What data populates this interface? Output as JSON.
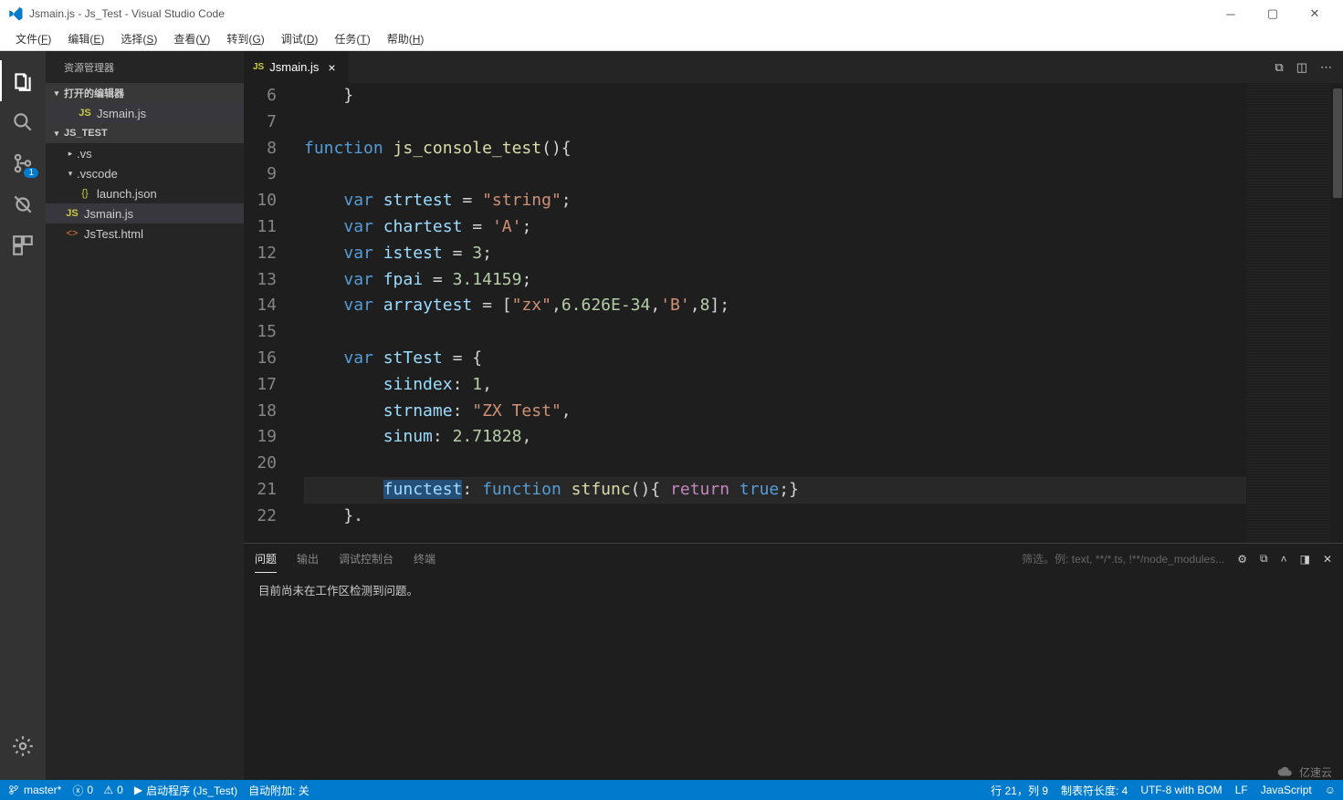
{
  "window": {
    "title": "Jsmain.js - Js_Test - Visual Studio Code"
  },
  "menu": {
    "items": [
      {
        "label": "文件",
        "mn": "F"
      },
      {
        "label": "编辑",
        "mn": "E"
      },
      {
        "label": "选择",
        "mn": "S"
      },
      {
        "label": "查看",
        "mn": "V"
      },
      {
        "label": "转到",
        "mn": "G"
      },
      {
        "label": "调试",
        "mn": "D"
      },
      {
        "label": "任务",
        "mn": "T"
      },
      {
        "label": "帮助",
        "mn": "H"
      }
    ]
  },
  "activity": {
    "debug_badge": "1"
  },
  "sidebar": {
    "title": "资源管理器",
    "open_editors": "打开的编辑器",
    "open_file": "Jsmain.js",
    "workspace": "JS_TEST",
    "folders": [
      {
        "name": ".vs",
        "expanded": false
      },
      {
        "name": ".vscode",
        "expanded": true
      }
    ],
    "files": {
      "launch": "launch.json",
      "jsmain": "Jsmain.js",
      "jstest": "JsTest.html"
    }
  },
  "tab": {
    "name": "Jsmain.js"
  },
  "code": {
    "lines": [
      {
        "n": "6",
        "tokens": [
          {
            "c": "tk-pl",
            "t": "    }"
          }
        ]
      },
      {
        "n": "7",
        "tokens": []
      },
      {
        "n": "8",
        "tokens": [
          {
            "c": "tk-kw",
            "t": "function"
          },
          {
            "c": "tk-pl",
            "t": " "
          },
          {
            "c": "tk-fn",
            "t": "js_console_test"
          },
          {
            "c": "tk-pl",
            "t": "(){"
          }
        ]
      },
      {
        "n": "9",
        "tokens": []
      },
      {
        "n": "10",
        "tokens": [
          {
            "c": "tk-pl",
            "t": "    "
          },
          {
            "c": "tk-kw",
            "t": "var"
          },
          {
            "c": "tk-pl",
            "t": " "
          },
          {
            "c": "tk-id",
            "t": "strtest"
          },
          {
            "c": "tk-pl",
            "t": " = "
          },
          {
            "c": "tk-str",
            "t": "\"string\""
          },
          {
            "c": "tk-pl",
            "t": ";"
          }
        ]
      },
      {
        "n": "11",
        "tokens": [
          {
            "c": "tk-pl",
            "t": "    "
          },
          {
            "c": "tk-kw",
            "t": "var"
          },
          {
            "c": "tk-pl",
            "t": " "
          },
          {
            "c": "tk-id",
            "t": "chartest"
          },
          {
            "c": "tk-pl",
            "t": " = "
          },
          {
            "c": "tk-str",
            "t": "'A'"
          },
          {
            "c": "tk-pl",
            "t": ";"
          }
        ]
      },
      {
        "n": "12",
        "tokens": [
          {
            "c": "tk-pl",
            "t": "    "
          },
          {
            "c": "tk-kw",
            "t": "var"
          },
          {
            "c": "tk-pl",
            "t": " "
          },
          {
            "c": "tk-id",
            "t": "istest"
          },
          {
            "c": "tk-pl",
            "t": " = "
          },
          {
            "c": "tk-num",
            "t": "3"
          },
          {
            "c": "tk-pl",
            "t": ";"
          }
        ]
      },
      {
        "n": "13",
        "tokens": [
          {
            "c": "tk-pl",
            "t": "    "
          },
          {
            "c": "tk-kw",
            "t": "var"
          },
          {
            "c": "tk-pl",
            "t": " "
          },
          {
            "c": "tk-id",
            "t": "fpai"
          },
          {
            "c": "tk-pl",
            "t": " = "
          },
          {
            "c": "tk-num",
            "t": "3.14159"
          },
          {
            "c": "tk-pl",
            "t": ";"
          }
        ]
      },
      {
        "n": "14",
        "tokens": [
          {
            "c": "tk-pl",
            "t": "    "
          },
          {
            "c": "tk-kw",
            "t": "var"
          },
          {
            "c": "tk-pl",
            "t": " "
          },
          {
            "c": "tk-id",
            "t": "arraytest"
          },
          {
            "c": "tk-pl",
            "t": " = ["
          },
          {
            "c": "tk-str",
            "t": "\"zx\""
          },
          {
            "c": "tk-pl",
            "t": ","
          },
          {
            "c": "tk-num",
            "t": "6.626E-34"
          },
          {
            "c": "tk-pl",
            "t": ","
          },
          {
            "c": "tk-str",
            "t": "'B'"
          },
          {
            "c": "tk-pl",
            "t": ","
          },
          {
            "c": "tk-num",
            "t": "8"
          },
          {
            "c": "tk-pl",
            "t": "];"
          }
        ]
      },
      {
        "n": "15",
        "tokens": []
      },
      {
        "n": "16",
        "tokens": [
          {
            "c": "tk-pl",
            "t": "    "
          },
          {
            "c": "tk-kw",
            "t": "var"
          },
          {
            "c": "tk-pl",
            "t": " "
          },
          {
            "c": "tk-id",
            "t": "stTest"
          },
          {
            "c": "tk-pl",
            "t": " = {"
          }
        ]
      },
      {
        "n": "17",
        "tokens": [
          {
            "c": "tk-pl",
            "t": "        "
          },
          {
            "c": "tk-id",
            "t": "siindex"
          },
          {
            "c": "tk-pl",
            "t": ": "
          },
          {
            "c": "tk-num",
            "t": "1"
          },
          {
            "c": "tk-pl",
            "t": ","
          }
        ]
      },
      {
        "n": "18",
        "tokens": [
          {
            "c": "tk-pl",
            "t": "        "
          },
          {
            "c": "tk-id",
            "t": "strname"
          },
          {
            "c": "tk-pl",
            "t": ": "
          },
          {
            "c": "tk-str",
            "t": "\"ZX Test\""
          },
          {
            "c": "tk-pl",
            "t": ","
          }
        ]
      },
      {
        "n": "19",
        "tokens": [
          {
            "c": "tk-pl",
            "t": "        "
          },
          {
            "c": "tk-id",
            "t": "sinum"
          },
          {
            "c": "tk-pl",
            "t": ": "
          },
          {
            "c": "tk-num",
            "t": "2.71828"
          },
          {
            "c": "tk-pl",
            "t": ","
          }
        ]
      },
      {
        "n": "20",
        "tokens": []
      },
      {
        "n": "21",
        "cur": true,
        "tokens": [
          {
            "c": "tk-pl",
            "t": "        "
          },
          {
            "c": "tk-id sel",
            "t": "functest"
          },
          {
            "c": "tk-pl",
            "t": ": "
          },
          {
            "c": "tk-kw",
            "t": "function"
          },
          {
            "c": "tk-pl",
            "t": " "
          },
          {
            "c": "tk-fn",
            "t": "stfunc"
          },
          {
            "c": "tk-pl",
            "t": "(){ "
          },
          {
            "c": "tk-ret",
            "t": "return"
          },
          {
            "c": "tk-pl",
            "t": " "
          },
          {
            "c": "tk-kw",
            "t": "true"
          },
          {
            "c": "tk-pl",
            "t": ";}"
          }
        ]
      },
      {
        "n": "22",
        "tokens": [
          {
            "c": "tk-pl",
            "t": "    }."
          }
        ]
      }
    ]
  },
  "panel": {
    "tabs": [
      "问题",
      "输出",
      "调试控制台",
      "终端"
    ],
    "filter_placeholder": "筛选。例: text, **/*.ts, !**/node_modules...",
    "body": "目前尚未在工作区检测到问题。"
  },
  "status": {
    "branch": "master*",
    "errors": "0",
    "warnings": "0",
    "launch": "启动程序 (Js_Test)",
    "attach": "自动附加: 关",
    "cursor": "行 21，列 9",
    "tabsize": "制表符长度: 4",
    "encoding": "UTF-8 with BOM",
    "eol": "LF",
    "lang": "JavaScript"
  },
  "watermark": "亿速云"
}
